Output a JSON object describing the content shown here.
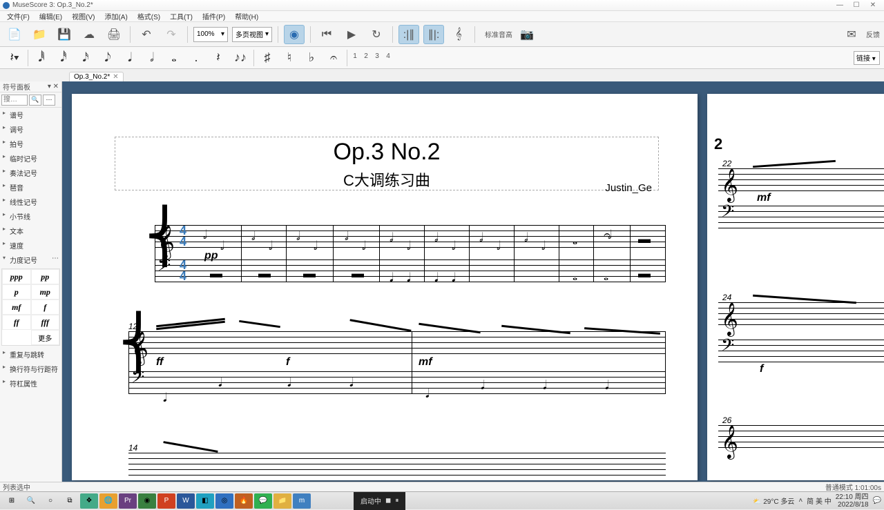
{
  "window": {
    "title": "MuseScore 3: Op.3_No.2*"
  },
  "menu": {
    "items": [
      "文件(F)",
      "编辑(E)",
      "视图(V)",
      "添加(A)",
      "格式(S)",
      "工具(T)",
      "插件(P)",
      "帮助(H)"
    ]
  },
  "toolbar1": {
    "zoom": "100%",
    "view_mode": "多页视图",
    "pitch_label": "标准音高",
    "feedback": "反馈"
  },
  "toolbar2": {
    "voices": [
      "1",
      "2",
      "3",
      "4"
    ],
    "right_select": "链接 ▾"
  },
  "doc_tab": {
    "label": "Op.3_No.2*"
  },
  "palette": {
    "header": "符号面板",
    "search_placeholder": "搜…",
    "items": [
      "谱号",
      "调号",
      "拍号",
      "临时记号",
      "奏法记号",
      "琶音",
      "线性记号",
      "小节线",
      "文本",
      "速度"
    ],
    "dynamics_label": "力度记号",
    "dynamics": [
      "ppp",
      "pp",
      "p",
      "mp",
      "mf",
      "f",
      "ff",
      "fff"
    ],
    "more": "更多",
    "footer_items": [
      "重复与跳转",
      "换行符与行距符",
      "符杠属性"
    ]
  },
  "score": {
    "title": "Op.3 No.2",
    "subtitle": "C大调练习曲",
    "composer": "Justin_Ge",
    "time_sig_top": "4",
    "time_sig_bot": "4",
    "dyn_pp": "pp",
    "dyn_ff": "ff",
    "dyn_f": "f",
    "dyn_mf": "mf",
    "meas12": "12",
    "meas14": "14",
    "meas22": "22",
    "meas24": "24",
    "meas26": "26",
    "page2_num": "2"
  },
  "status": {
    "left": "列表选中",
    "right": "普通模式    1:01:00s"
  },
  "media": {
    "label": "启动中"
  },
  "tray": {
    "weather": "29°C 多云",
    "ime": "简 美 中",
    "time": "22:10 周四",
    "date": "2022/8/18"
  }
}
